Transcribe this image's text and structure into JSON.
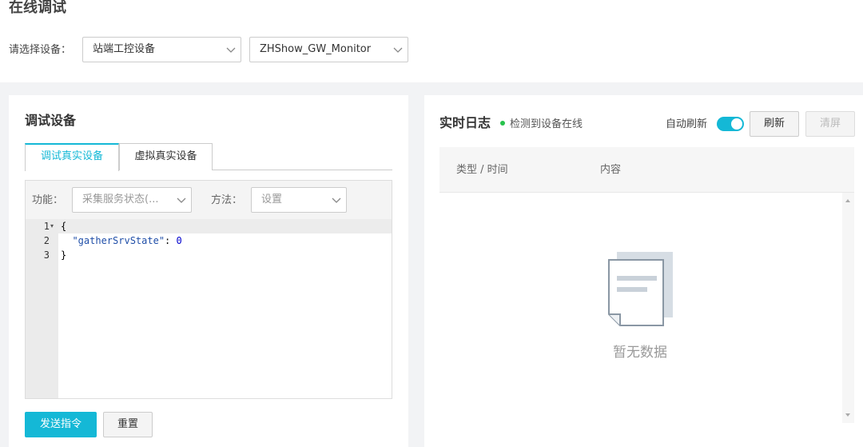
{
  "page": {
    "title": "在线调试"
  },
  "device_select": {
    "label": "请选择设备：",
    "category_value": "站端工控设备",
    "device_value": "ZHShow_GW_Monitor"
  },
  "debug_panel": {
    "title": "调试设备",
    "tabs": [
      {
        "label": "调试真实设备",
        "active": true
      },
      {
        "label": "虚拟真实设备",
        "active": false
      }
    ],
    "function_label": "功能：",
    "function_value": "采集服务状态(...",
    "method_label": "方法：",
    "method_value": "设置",
    "code_lines": [
      {
        "no": "1",
        "text": "{"
      },
      {
        "no": "2",
        "key": "\"gatherSrvState\"",
        "sep": ": ",
        "value": "0"
      },
      {
        "no": "3",
        "text": "}"
      }
    ],
    "send_button": "发送指令",
    "reset_button": "重置"
  },
  "log_panel": {
    "title": "实时日志",
    "status": "检测到设备在线",
    "auto_refresh_label": "自动刷新",
    "auto_refresh_on": true,
    "refresh_button": "刷新",
    "clear_button": "清屏",
    "columns": [
      "类型 / 时间",
      "内容"
    ],
    "empty_text": "暂无数据"
  },
  "colors": {
    "accent": "#14b8d6",
    "online": "#27c24c"
  }
}
